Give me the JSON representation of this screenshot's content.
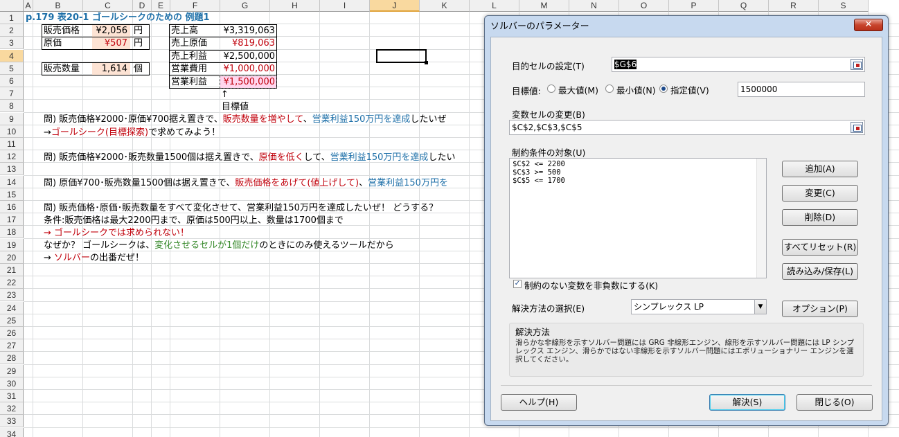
{
  "columns": [
    "A",
    "B",
    "C",
    "D",
    "E",
    "F",
    "G",
    "H",
    "I",
    "J",
    "K",
    "L",
    "M",
    "N",
    "O",
    "P",
    "Q",
    "R",
    "S"
  ],
  "rows": [
    "1",
    "2",
    "3",
    "4",
    "5",
    "6",
    "7",
    "8",
    "9",
    "10",
    "11",
    "12",
    "13",
    "14",
    "15",
    "16",
    "17",
    "18",
    "19",
    "20",
    "21",
    "22",
    "23",
    "24",
    "25",
    "26",
    "27",
    "28",
    "29",
    "30",
    "31",
    "32",
    "33",
    "34"
  ],
  "sheet": {
    "title": "p.179  表20-1  ゴールシークのための 例題1",
    "price_label": "販売価格",
    "price_value": "¥2,056",
    "price_unit": "円",
    "cost_label": "原価",
    "cost_value": "¥507",
    "cost_unit": "円",
    "qty_label": "販売数量",
    "qty_value": "1,614",
    "qty_unit": "個",
    "sales_label": "売上高",
    "sales_value": "¥3,319,063",
    "cogs_label": "売上原価",
    "cogs_value": "¥819,063",
    "gross_label": "売上利益",
    "gross_value": "¥2,500,000",
    "opex_label": "営業費用",
    "opex_value": "¥1,000,000",
    "op_label": "営業利益",
    "op_value": "¥1,500,000",
    "arrow": "↑",
    "target_label": "目標値",
    "q1_a": "問)  販売価格¥2000･原価¥700据え置きで、",
    "q1_b": "販売数量を増やして",
    "q1_c": "、",
    "q1_d": "営業利益150万円を達成",
    "q1_e": "したいぜ",
    "q1b_a": "→",
    "q1b_b": "ゴールシーク(目標探索)",
    "q1b_c": "で求めてみよう！",
    "q2_a": "問)  販売価格¥2000･販売数量1500個は据え置きで、",
    "q2_b": "原価を低く",
    "q2_c": "して、",
    "q2_d": "営業利益150万円を達成",
    "q2_e": "したい",
    "q3_a": "問)  原価¥700･販売数量1500個は据え置きで、",
    "q3_b": "販売価格をあげて(値上げして)",
    "q3_c": "、",
    "q3_d": "営業利益150万円を",
    "q4": "問)  販売価格･原価･販売数量をすべて変化させて、営業利益150万円を達成したいぜ！   どうする？",
    "cond": "条件:販売価格は最大2200円まで、原価は500円以上、数量は1700個まで",
    "r18": "→  ゴールシークでは求められない！",
    "r19_a": "なぜか？  ゴールシークは、",
    "r19_b": "変化させるセルが1個だけ",
    "r19_c": "のときにのみ使えるツールだから",
    "r20_a": "→  ",
    "r20_b": "ソルバー",
    "r20_c": "の出番だぜ！"
  },
  "dialog": {
    "title": "ソルバーのパラメーター",
    "close": "✕",
    "objective_label": "目的セルの設定(T)",
    "objective_value": "$G$6",
    "to_label": "目標値:",
    "opt_max": "最大値(M)",
    "opt_min": "最小値(N)",
    "opt_value": "指定値(V)",
    "value_of": "1500000",
    "changing_label": "変数セルの変更(B)",
    "changing_value": "$C$2,$C$3,$C$5",
    "constraints_label": "制約条件の対象(U)",
    "constraints": [
      "$C$2 <= 2200",
      "$C$3 >= 500",
      "$C$5 <= 1700"
    ],
    "btn_add": "追加(A)",
    "btn_change": "変更(C)",
    "btn_delete": "削除(D)",
    "btn_reset": "すべてリセット(R)",
    "btn_loadsave": "読み込み/保存(L)",
    "nonneg_label": "制約のない変数を非負数にする(K)",
    "method_label": "解決方法の選択(E)",
    "method_value": "シンプレックス LP",
    "btn_options": "オプション(P)",
    "desc_title": "解決方法",
    "desc_text": "滑らかな非線形を示すソルバー問題には GRG 非線形エンジン、線形を示すソルバー問題には LP シンプレックス エンジン、滑らかではない非線形を示すソルバー問題にはエボリューショナリー エンジンを選択してください。",
    "btn_help": "ヘルプ(H)",
    "btn_solve": "解決(S)",
    "btn_close": "閉じる(O)"
  }
}
